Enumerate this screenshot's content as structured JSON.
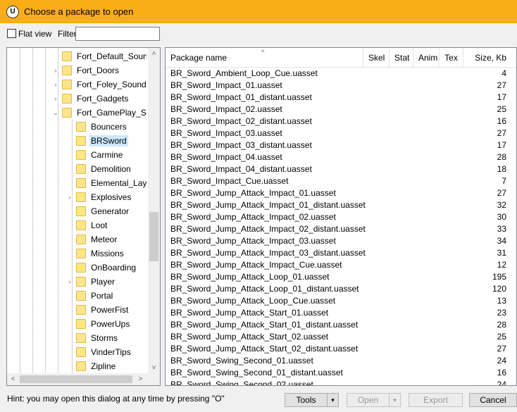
{
  "window": {
    "title": "Choose a package to open",
    "icon_text": "U"
  },
  "toolbar": {
    "flat_view_label": "Flat view",
    "filter_label": "Filter:",
    "filter_value": ""
  },
  "tree": {
    "items": [
      {
        "label": "Fort_Default_Sound",
        "indent": 1,
        "expander": "",
        "selected": false
      },
      {
        "label": "Fort_Doors",
        "indent": 1,
        "expander": "›",
        "selected": false
      },
      {
        "label": "Fort_Foley_Sounds",
        "indent": 1,
        "expander": "›",
        "selected": false
      },
      {
        "label": "Fort_Gadgets",
        "indent": 1,
        "expander": "›",
        "selected": false
      },
      {
        "label": "Fort_GamePlay_Sou",
        "indent": 1,
        "expander": "⌄",
        "selected": false
      },
      {
        "label": "Bouncers",
        "indent": 2,
        "expander": "",
        "selected": false
      },
      {
        "label": "BRSword",
        "indent": 2,
        "expander": "",
        "selected": true
      },
      {
        "label": "Carmine",
        "indent": 2,
        "expander": "",
        "selected": false
      },
      {
        "label": "Demolition",
        "indent": 2,
        "expander": "",
        "selected": false
      },
      {
        "label": "Elemental_Layer",
        "indent": 2,
        "expander": "",
        "selected": false
      },
      {
        "label": "Explosives",
        "indent": 2,
        "expander": "›",
        "selected": false
      },
      {
        "label": "Generator",
        "indent": 2,
        "expander": "",
        "selected": false
      },
      {
        "label": "Loot",
        "indent": 2,
        "expander": "",
        "selected": false
      },
      {
        "label": "Meteor",
        "indent": 2,
        "expander": "",
        "selected": false
      },
      {
        "label": "Missions",
        "indent": 2,
        "expander": "",
        "selected": false
      },
      {
        "label": "OnBoarding",
        "indent": 2,
        "expander": "",
        "selected": false
      },
      {
        "label": "Player",
        "indent": 2,
        "expander": "›",
        "selected": false
      },
      {
        "label": "Portal",
        "indent": 2,
        "expander": "",
        "selected": false
      },
      {
        "label": "PowerFist",
        "indent": 2,
        "expander": "",
        "selected": false
      },
      {
        "label": "PowerUps",
        "indent": 2,
        "expander": "",
        "selected": false
      },
      {
        "label": "Storms",
        "indent": 2,
        "expander": "",
        "selected": false
      },
      {
        "label": "VinderTips",
        "indent": 2,
        "expander": "",
        "selected": false
      },
      {
        "label": "Zipline",
        "indent": 2,
        "expander": "",
        "selected": false
      }
    ],
    "scroll_up": "˄",
    "scroll_down": "˅",
    "scroll_left": "<",
    "scroll_right": ">"
  },
  "list": {
    "columns": {
      "name": "Package name",
      "skel": "Skel",
      "stat": "Stat",
      "anim": "Anim",
      "tex": "Tex",
      "size": "Size, Kb"
    },
    "sort_indicator": "^",
    "rows": [
      {
        "name": "BR_Sword_Ambient_Loop_Cue.uasset",
        "size": "4"
      },
      {
        "name": "BR_Sword_Impact_01.uasset",
        "size": "27"
      },
      {
        "name": "BR_Sword_Impact_01_distant.uasset",
        "size": "17"
      },
      {
        "name": "BR_Sword_Impact_02.uasset",
        "size": "25"
      },
      {
        "name": "BR_Sword_Impact_02_distant.uasset",
        "size": "16"
      },
      {
        "name": "BR_Sword_Impact_03.uasset",
        "size": "27"
      },
      {
        "name": "BR_Sword_Impact_03_distant.uasset",
        "size": "17"
      },
      {
        "name": "BR_Sword_Impact_04.uasset",
        "size": "28"
      },
      {
        "name": "BR_Sword_Impact_04_distant.uasset",
        "size": "18"
      },
      {
        "name": "BR_Sword_Impact_Cue.uasset",
        "size": "7"
      },
      {
        "name": "BR_Sword_Jump_Attack_Impact_01.uasset",
        "size": "27"
      },
      {
        "name": "BR_Sword_Jump_Attack_Impact_01_distant.uasset",
        "size": "32"
      },
      {
        "name": "BR_Sword_Jump_Attack_Impact_02.uasset",
        "size": "30"
      },
      {
        "name": "BR_Sword_Jump_Attack_Impact_02_distant.uasset",
        "size": "33"
      },
      {
        "name": "BR_Sword_Jump_Attack_Impact_03.uasset",
        "size": "34"
      },
      {
        "name": "BR_Sword_Jump_Attack_Impact_03_distant.uasset",
        "size": "31"
      },
      {
        "name": "BR_Sword_Jump_Attack_Impact_Cue.uasset",
        "size": "12"
      },
      {
        "name": "BR_Sword_Jump_Attack_Loop_01.uasset",
        "size": "195"
      },
      {
        "name": "BR_Sword_Jump_Attack_Loop_01_distant.uasset",
        "size": "120"
      },
      {
        "name": "BR_Sword_Jump_Attack_Loop_Cue.uasset",
        "size": "13"
      },
      {
        "name": "BR_Sword_Jump_Attack_Start_01.uasset",
        "size": "23"
      },
      {
        "name": "BR_Sword_Jump_Attack_Start_01_distant.uasset",
        "size": "28"
      },
      {
        "name": "BR_Sword_Jump_Attack_Start_02.uasset",
        "size": "25"
      },
      {
        "name": "BR_Sword_Jump_Attack_Start_02_distant.uasset",
        "size": "27"
      },
      {
        "name": "BR_Sword_Swing_Second_01.uasset",
        "size": "24"
      },
      {
        "name": "BR_Sword_Swing_Second_01_distant.uasset",
        "size": "16"
      },
      {
        "name": "BR_Sword_Swing_Second_02.uasset",
        "size": "24"
      }
    ]
  },
  "footer": {
    "hint": "Hint: you may open this dialog at any time by pressing \"O\"",
    "tools_label": "Tools",
    "open_label": "Open",
    "export_label": "Export",
    "cancel_label": "Cancel",
    "dropdown_glyph": "▾"
  },
  "colors": {
    "titlebar": "#fbad18",
    "selection": "#cce8ff",
    "folder": "#fde68a"
  }
}
